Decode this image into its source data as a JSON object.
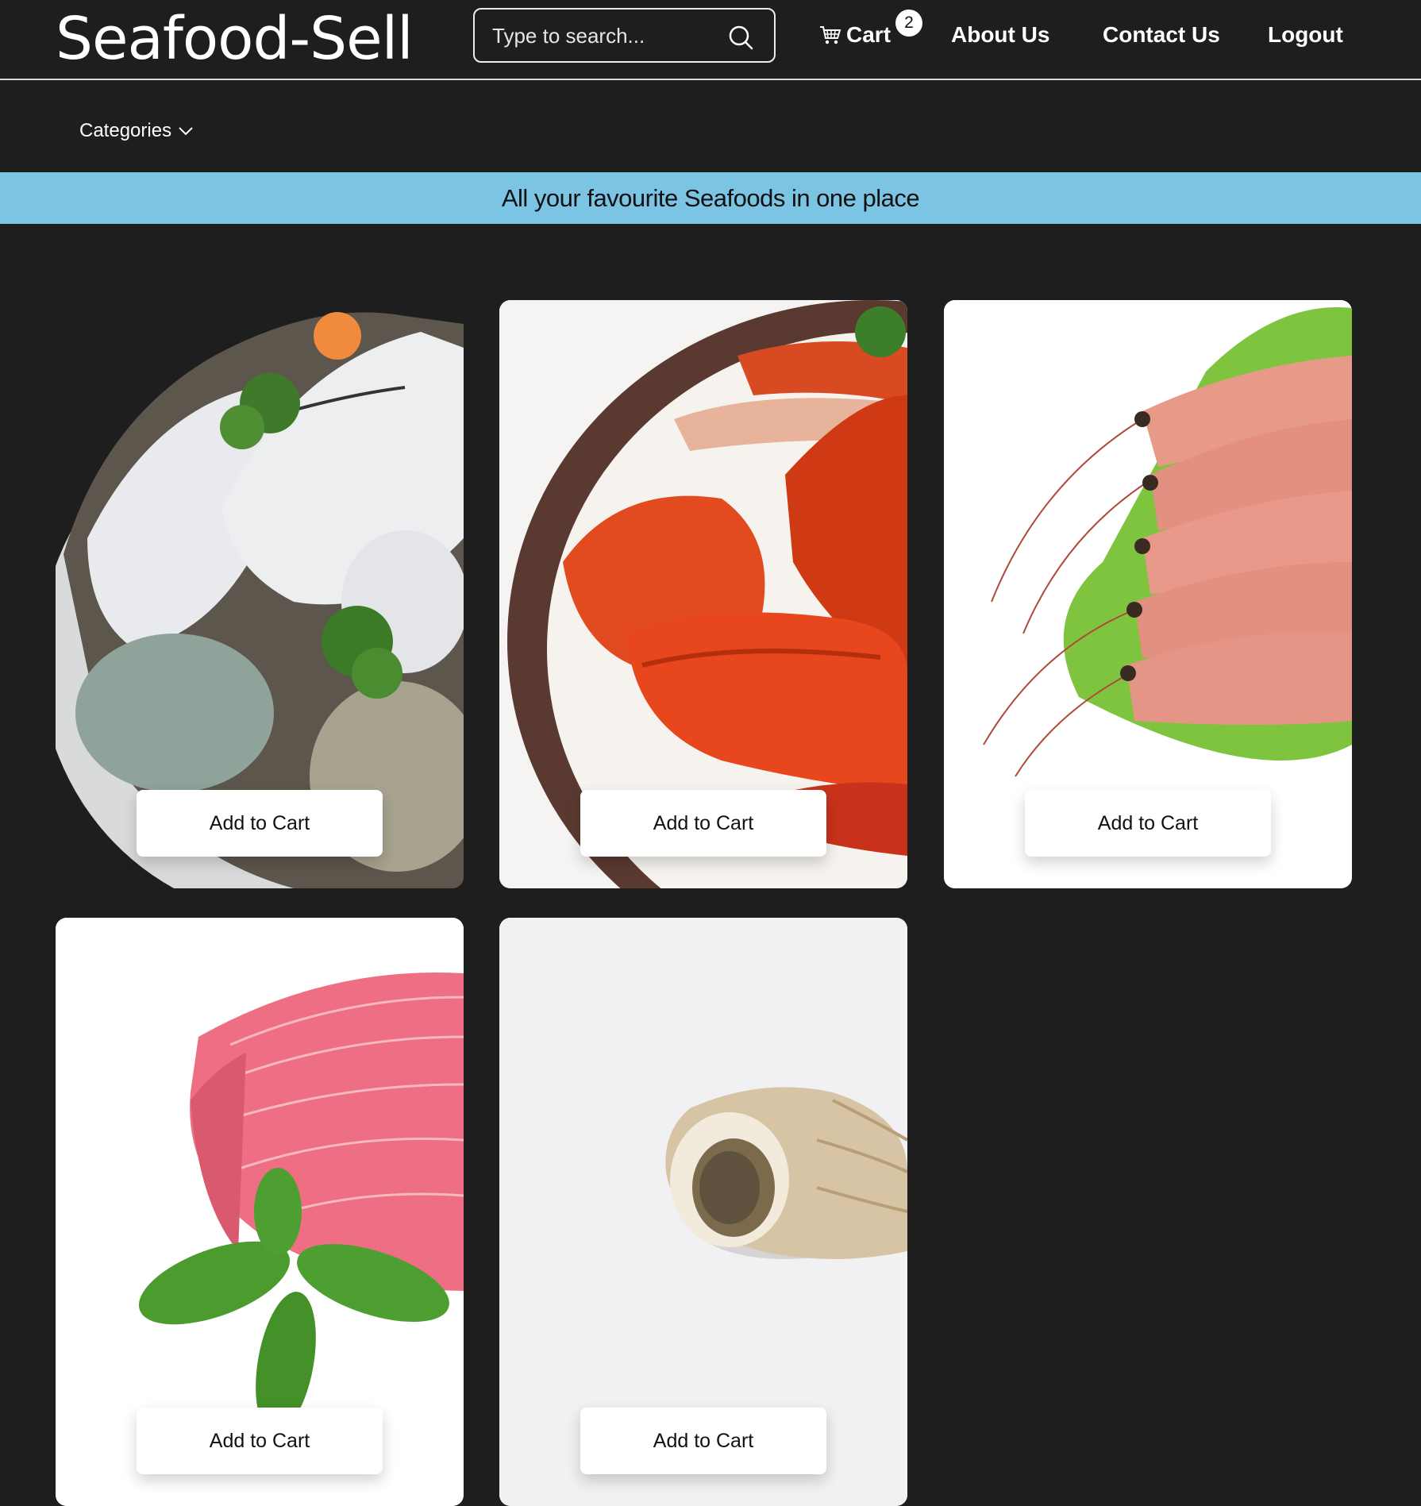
{
  "navbar": {
    "brand": "Seafood-Sell",
    "search": {
      "placeholder": "Type to search...",
      "value": ""
    },
    "cart": {
      "label": "Cart",
      "count": "2"
    },
    "links": {
      "about": "About Us",
      "contact": "Contact Us",
      "logout": "Logout"
    }
  },
  "subnav": {
    "categories_label": "Categories"
  },
  "banner": {
    "text": "All your favourite Seafoods in one place"
  },
  "products": [
    {
      "image": "oysters",
      "button_label": "Add to Cart"
    },
    {
      "image": "crab",
      "button_label": "Add to Cart"
    },
    {
      "image": "prawns",
      "button_label": "Add to Cart"
    },
    {
      "image": "tuna-steak",
      "button_label": "Add to Cart"
    },
    {
      "image": "whelk-shell",
      "button_label": "Add to Cart"
    }
  ],
  "colors": {
    "background": "#1e1e1f",
    "banner": "#7cc4e4",
    "text_light": "#ffffff"
  }
}
